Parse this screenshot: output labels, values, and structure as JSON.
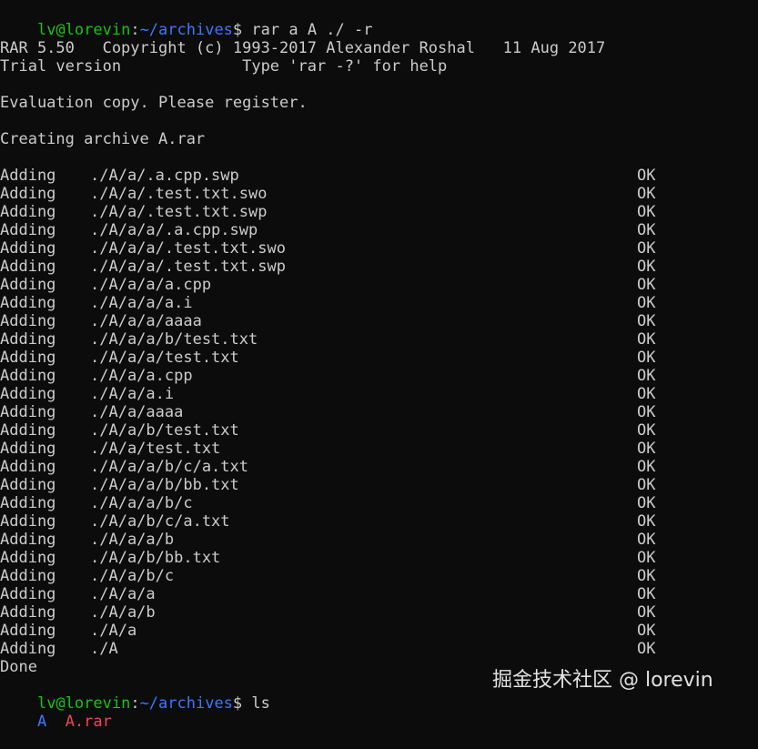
{
  "prompt": {
    "user_host": "lv@lorevin",
    "colon": ":",
    "path": "~/archives",
    "dollar": "$",
    "command1": "rar a A ./ -r",
    "command2": "ls"
  },
  "header": {
    "line1": "RAR 5.50   Copyright (c) 1993-2017 Alexander Roshal   11 Aug 2017",
    "line2": "Trial version             Type 'rar -?' for help",
    "evaluation": "Evaluation copy. Please register.",
    "creating": "Creating archive A.rar"
  },
  "adding": [
    {
      "action": "Adding",
      "path": "./A/a/.a.cpp.swp",
      "status": "OK"
    },
    {
      "action": "Adding",
      "path": "./A/a/.test.txt.swo",
      "status": "OK"
    },
    {
      "action": "Adding",
      "path": "./A/a/.test.txt.swp",
      "status": "OK"
    },
    {
      "action": "Adding",
      "path": "./A/a/a/.a.cpp.swp",
      "status": "OK"
    },
    {
      "action": "Adding",
      "path": "./A/a/a/.test.txt.swo",
      "status": "OK"
    },
    {
      "action": "Adding",
      "path": "./A/a/a/.test.txt.swp",
      "status": "OK"
    },
    {
      "action": "Adding",
      "path": "./A/a/a/a.cpp",
      "status": "OK"
    },
    {
      "action": "Adding",
      "path": "./A/a/a/a.i",
      "status": "OK"
    },
    {
      "action": "Adding",
      "path": "./A/a/a/aaaa",
      "status": "OK"
    },
    {
      "action": "Adding",
      "path": "./A/a/a/b/test.txt",
      "status": "OK"
    },
    {
      "action": "Adding",
      "path": "./A/a/a/test.txt",
      "status": "OK"
    },
    {
      "action": "Adding",
      "path": "./A/a/a.cpp",
      "status": "OK"
    },
    {
      "action": "Adding",
      "path": "./A/a/a.i",
      "status": "OK"
    },
    {
      "action": "Adding",
      "path": "./A/a/aaaa",
      "status": "OK"
    },
    {
      "action": "Adding",
      "path": "./A/a/b/test.txt",
      "status": "OK"
    },
    {
      "action": "Adding",
      "path": "./A/a/test.txt",
      "status": "OK"
    },
    {
      "action": "Adding",
      "path": "./A/a/a/b/c/a.txt",
      "status": "OK"
    },
    {
      "action": "Adding",
      "path": "./A/a/a/b/bb.txt",
      "status": "OK"
    },
    {
      "action": "Adding",
      "path": "./A/a/a/b/c",
      "status": "OK"
    },
    {
      "action": "Adding",
      "path": "./A/a/b/c/a.txt",
      "status": "OK"
    },
    {
      "action": "Adding",
      "path": "./A/a/a/b",
      "status": "OK"
    },
    {
      "action": "Adding",
      "path": "./A/a/b/bb.txt",
      "status": "OK"
    },
    {
      "action": "Adding",
      "path": "./A/a/b/c",
      "status": "OK"
    },
    {
      "action": "Adding",
      "path": "./A/a/a",
      "status": "OK"
    },
    {
      "action": "Adding",
      "path": "./A/a/b",
      "status": "OK"
    },
    {
      "action": "Adding",
      "path": "./A/a",
      "status": "OK"
    },
    {
      "action": "Adding",
      "path": "./A",
      "status": "OK"
    }
  ],
  "done": "Done",
  "ls_output": {
    "dir": "A",
    "archive": "A.rar"
  },
  "watermark": "掘金技术社区 @ lorevin",
  "colors": {
    "background": "#0c0c0c",
    "text": "#cccccc",
    "prompt_user": "#16c60c",
    "prompt_path": "#3b78ff",
    "directory": "#3b78ff",
    "archive": "#e74856"
  }
}
